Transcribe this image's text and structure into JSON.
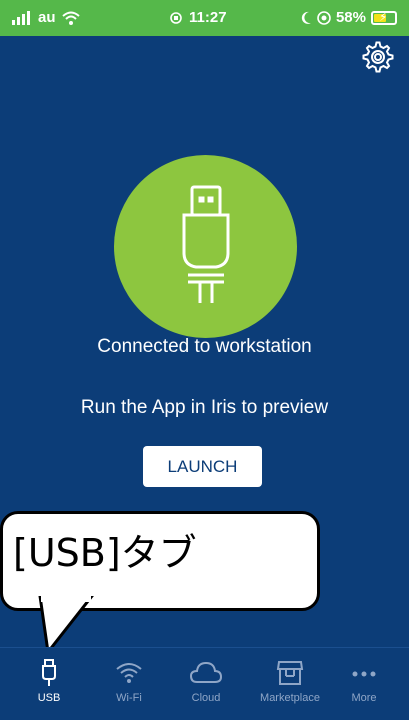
{
  "status_bar": {
    "carrier": "au",
    "time": "11:27",
    "battery_percent": "58%",
    "battery_level": 0.58
  },
  "main": {
    "status_message": "Connected to workstation",
    "hint": "Run the App in Iris to preview",
    "launch_label": "LAUNCH"
  },
  "callout": {
    "text": "[USB]タブ"
  },
  "tab_bar": {
    "tabs": [
      {
        "label": "USB",
        "icon": "usb-icon",
        "active": true
      },
      {
        "label": "Wi-Fi",
        "icon": "wifi-icon",
        "active": false
      },
      {
        "label": "Cloud",
        "icon": "cloud-icon",
        "active": false
      },
      {
        "label": "Marketplace",
        "icon": "storefront-icon",
        "active": false
      },
      {
        "label": "More",
        "icon": "more-icon",
        "active": false
      }
    ]
  },
  "colors": {
    "background": "#0c3d78",
    "status_bar": "#55b84a",
    "accent_green": "#8dc63f",
    "tab_inactive": "#8fa6c7"
  }
}
